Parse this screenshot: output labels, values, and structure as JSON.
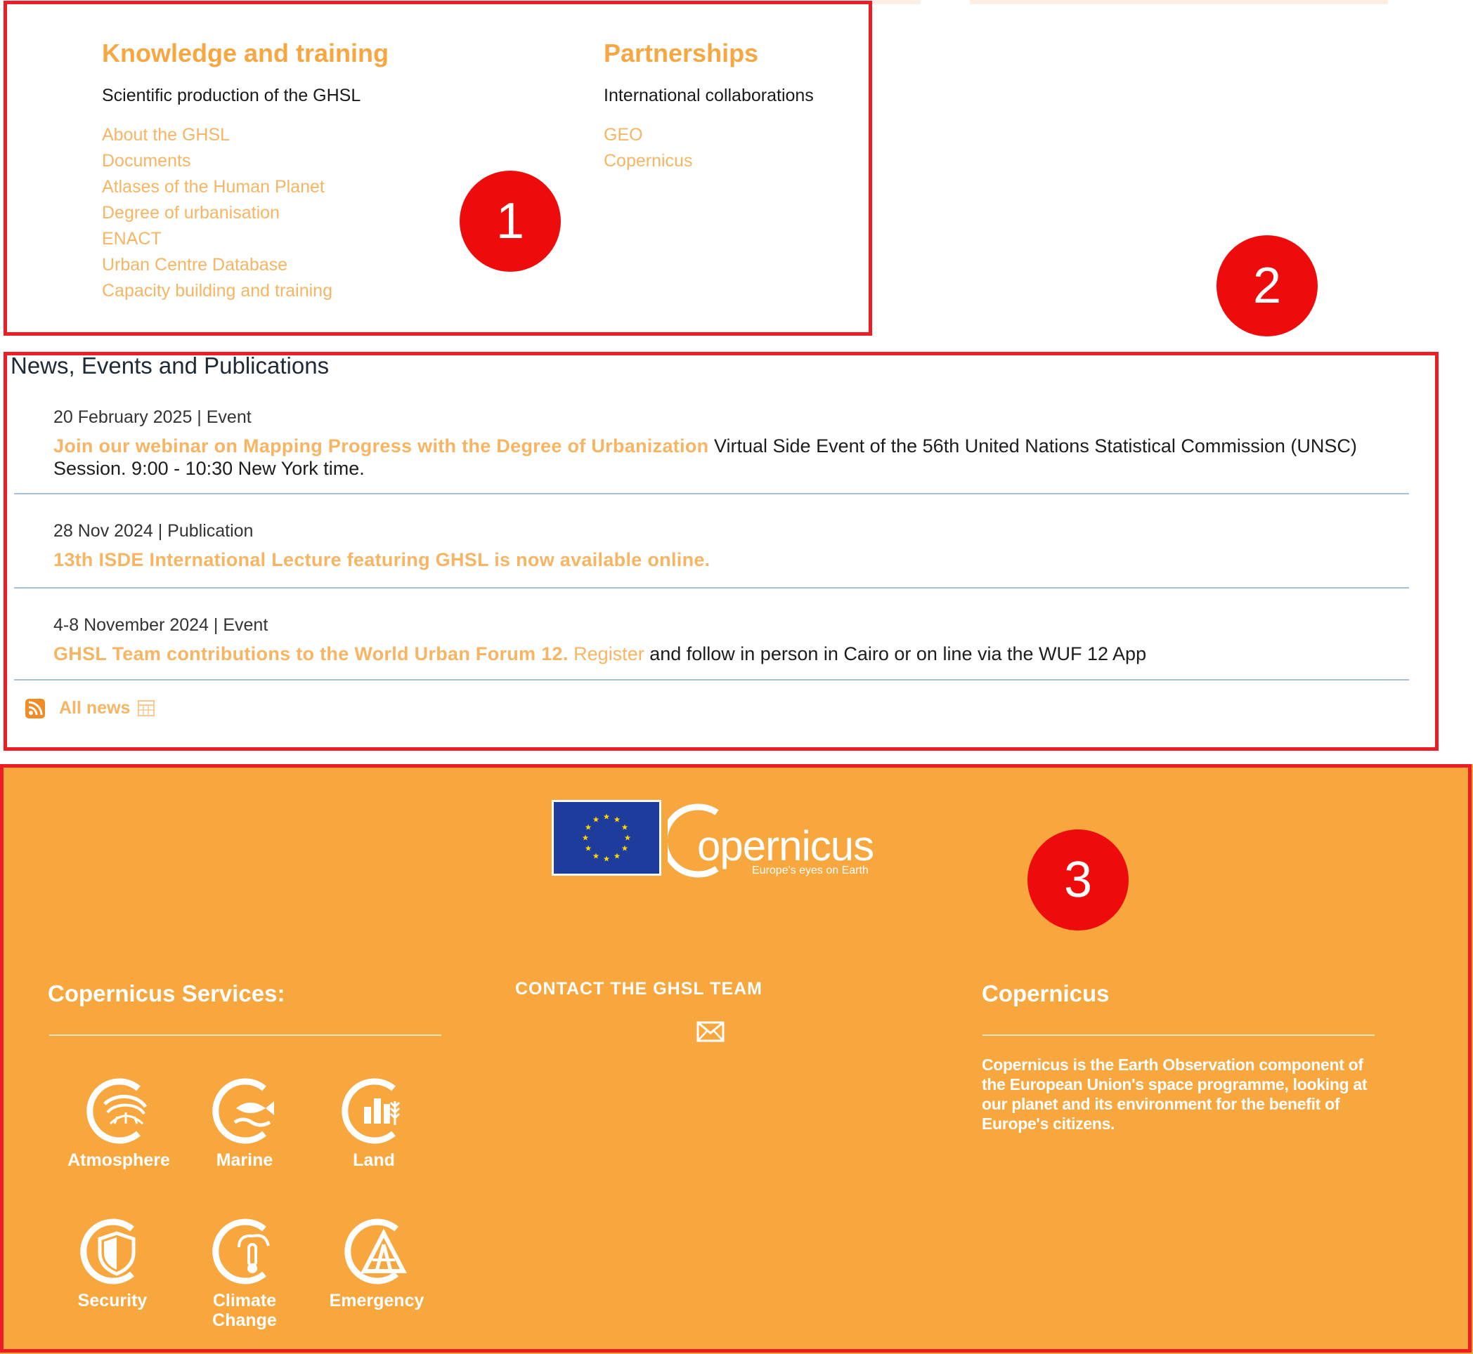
{
  "annotations": [
    "1",
    "2",
    "3"
  ],
  "knowledge": {
    "title": "Knowledge and training",
    "subtitle": "Scientific production of the GHSL",
    "links": [
      "About the GHSL",
      "Documents",
      "Atlases of the Human Planet",
      "Degree of urbanisation",
      "ENACT",
      "Urban Centre Database",
      "Capacity building and training"
    ]
  },
  "partnerships": {
    "title": "Partnerships",
    "subtitle": "International collaborations",
    "links": [
      "GEO",
      "Copernicus"
    ]
  },
  "news": {
    "heading": "News, Events and Publications",
    "items": [
      {
        "meta": "20 February 2025 | Event",
        "link": "Join our webinar on Mapping Progress with the Degree of Urbanization",
        "text": " Virtual Side Event of the 56th United Nations Statistical Commission (UNSC) Session. 9:00 - 10:30 New York time."
      },
      {
        "meta": "28 Nov 2024 | Publication",
        "link": "13th ISDE International Lecture featuring GHSL is now available online."
      },
      {
        "meta": "4-8 November 2024 | Event",
        "link": "GHSL Team contributions to the World Urban Forum 12.",
        "link2": " Register",
        "text": " and follow in person in Cairo or on line via the WUF 12 App"
      }
    ],
    "all_news": "All news"
  },
  "footer": {
    "logo_text": "opernicus",
    "logo_tagline": "Europe's eyes on Earth",
    "services_title": "Copernicus Services:",
    "services": [
      "Atmosphere",
      "Marine",
      "Land",
      "Security",
      "Climate",
      "Change",
      "Emergency"
    ],
    "contact_title": "CONTACT THE GHSL TEAM",
    "copernicus_title": "Copernicus",
    "copernicus_text": "Copernicus is the Earth Observation component of the European Union's space programme, looking at our planet and its environment for the benefit of Europe's citizens."
  },
  "colors": {
    "accent_orange": "#f7a741",
    "link_orange": "#f7b564",
    "footer_bg": "#f8a73e",
    "annotation_red": "#ee1c25",
    "eu_blue": "#1d3c9c",
    "eu_star": "#ffd200"
  },
  "icons": [
    "rss-icon",
    "calendar-icon",
    "mail-icon",
    "eu-flag-icon",
    "atmosphere-icon",
    "marine-icon",
    "land-icon",
    "security-icon",
    "climate-change-icon",
    "emergency-icon"
  ]
}
